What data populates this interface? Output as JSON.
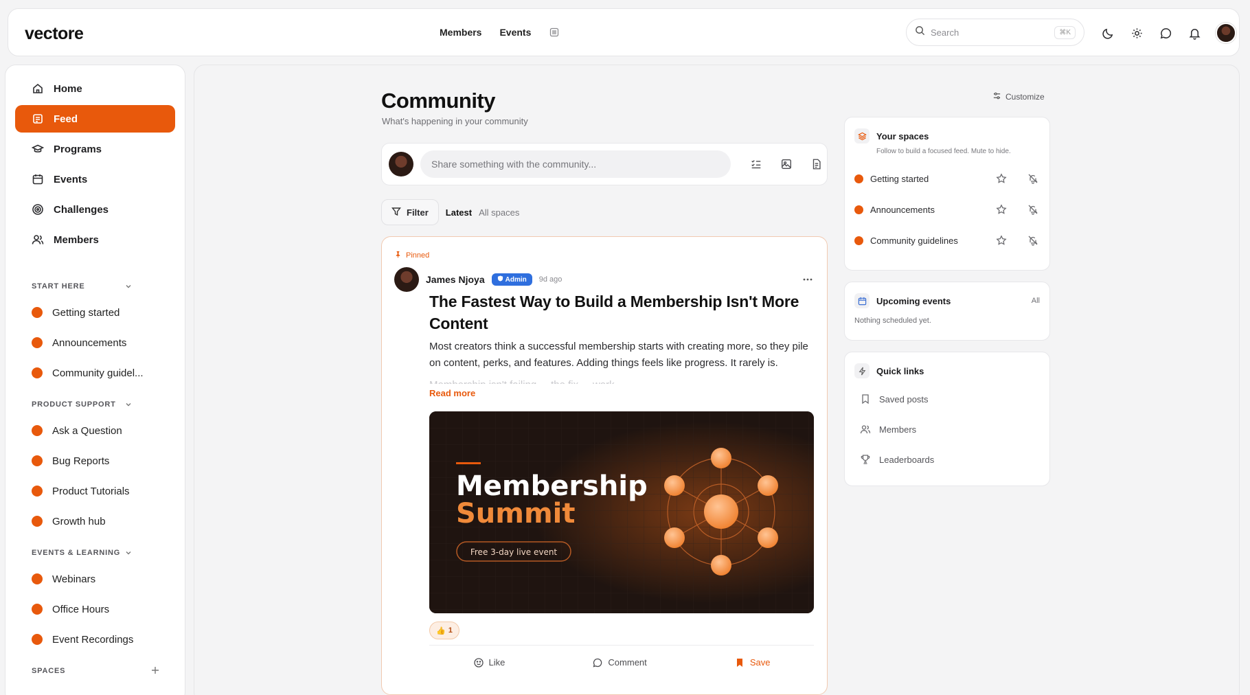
{
  "app": {
    "logo": "vectore"
  },
  "topnav": {
    "members": "Members",
    "events": "Events"
  },
  "search": {
    "placeholder": "Search",
    "shortcut": "⌘K"
  },
  "sidebar": {
    "nav": [
      {
        "label": "Home",
        "icon": "home-icon"
      },
      {
        "label": "Feed",
        "icon": "feed-icon",
        "active": true
      },
      {
        "label": "Programs",
        "icon": "graduation-cap-icon"
      },
      {
        "label": "Events",
        "icon": "calendar-icon"
      },
      {
        "label": "Challenges",
        "icon": "target-icon"
      },
      {
        "label": "Members",
        "icon": "users-icon"
      }
    ],
    "sections": [
      {
        "title": "START HERE",
        "items": [
          "Getting started",
          "Announcements",
          "Community guidel..."
        ]
      },
      {
        "title": "PRODUCT SUPPORT",
        "items": [
          "Ask a Question",
          "Bug Reports",
          "Product Tutorials",
          "Growth hub"
        ]
      },
      {
        "title": "EVENTS & LEARNING",
        "items": [
          "Webinars",
          "Office Hours",
          "Event Recordings"
        ]
      }
    ],
    "spaces_title": "SPACES",
    "accent": "#e8590c"
  },
  "main": {
    "title": "Community",
    "subtitle": "What's happening in your community",
    "customize": "Customize",
    "composer_placeholder": "Share something with the community...",
    "filter": {
      "button": "Filter",
      "sort": "Latest",
      "scope": "All spaces"
    }
  },
  "post": {
    "pinned": "Pinned",
    "author": "James Njoya",
    "badge": "Admin",
    "time": "9d ago",
    "title": "The Fastest Way to Build a Membership Isn't More Content",
    "body": "Most creators think a successful membership starts with creating more, so they pile on content, perks, and features. Adding things feels like progress. It rarely is.",
    "body_faded": "Membership isn't failing ... the fix ... work",
    "read_more": "Read more",
    "hero": {
      "line1": "Membership",
      "line2": "Summit",
      "pill": "Free 3-day live event"
    },
    "reaction": {
      "emoji": "👍",
      "count": "1"
    },
    "actions": {
      "like": "Like",
      "comment": "Comment",
      "save": "Save"
    }
  },
  "right": {
    "spaces": {
      "title": "Your spaces",
      "subtitle": "Follow to build a focused feed. Mute to hide.",
      "items": [
        "Getting started",
        "Announcements",
        "Community guidelines"
      ]
    },
    "events": {
      "title": "Upcoming events",
      "all": "All",
      "empty": "Nothing scheduled yet."
    },
    "quick": {
      "title": "Quick links",
      "items": [
        "Saved posts",
        "Members",
        "Leaderboards"
      ]
    }
  }
}
